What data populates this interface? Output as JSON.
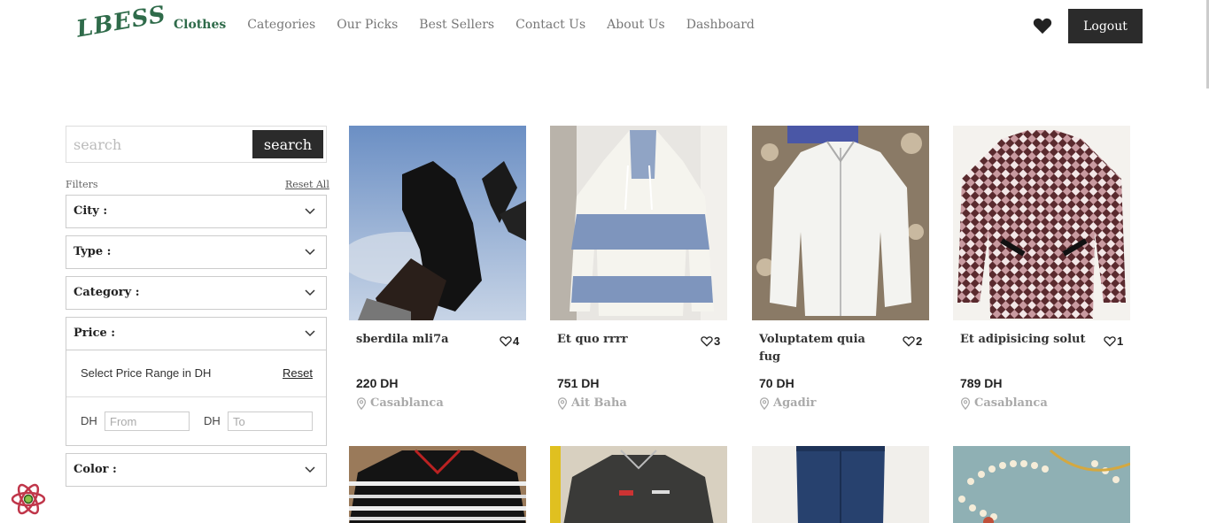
{
  "header": {
    "logo": "LBESS",
    "nav": [
      "Clothes",
      "Categories",
      "Our Picks",
      "Best Sellers",
      "Contact Us",
      "About Us",
      "Dashboard"
    ],
    "logout_label": "Logout"
  },
  "sidebar": {
    "search_placeholder": "search",
    "search_button": "search",
    "filters_label": "Filters",
    "reset_all": "Reset All",
    "filters": [
      "City :",
      "Type :",
      "Category :",
      "Price :",
      "Color :"
    ],
    "price": {
      "range_label": "Select Price Range in DH",
      "reset": "Reset",
      "currency": "DH",
      "from_placeholder": "From",
      "to_placeholder": "To"
    }
  },
  "products": [
    {
      "title": "sberdila mli7a",
      "likes": "4",
      "price": "220 DH",
      "city": "Casablanca"
    },
    {
      "title": "Et quo rrrr",
      "likes": "3",
      "price": "751 DH",
      "city": "Ait Baha"
    },
    {
      "title": "Voluptatem quia fug",
      "likes": "2",
      "price": "70 DH",
      "city": "Agadir"
    },
    {
      "title": "Et adipisicing solut",
      "likes": "1",
      "price": "789 DH",
      "city": "Casablanca"
    }
  ],
  "colors": {
    "brand_green": "#2f6b4a",
    "dark_button": "#2b2b2b"
  }
}
